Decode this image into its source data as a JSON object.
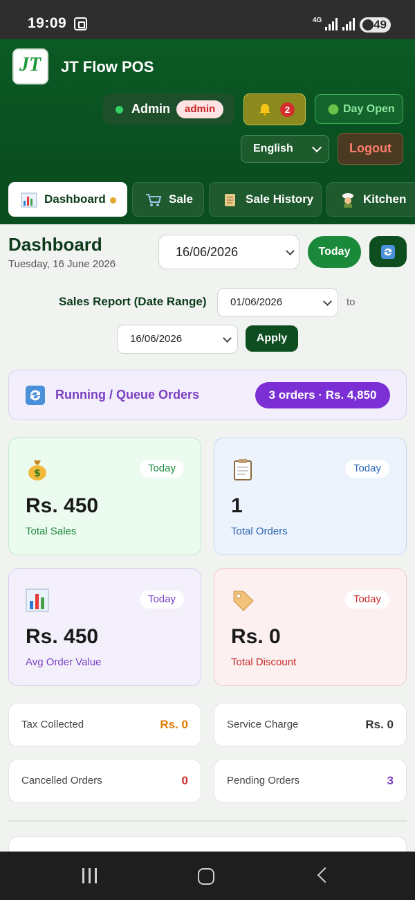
{
  "status_bar": {
    "time": "19:09",
    "network": "4G",
    "battery": "49"
  },
  "header": {
    "app_title": "JT Flow POS",
    "user_name": "Admin",
    "user_role": "admin",
    "notification_count": "2",
    "day_status": "Day Open",
    "language": "English",
    "logout_label": "Logout"
  },
  "tabs": [
    {
      "label": "Dashboard",
      "active": true
    },
    {
      "label": "Sale"
    },
    {
      "label": "Sale History"
    },
    {
      "label": "Kitchen"
    }
  ],
  "dashboard": {
    "title": "Dashboard",
    "date_long": "Tuesday, 16 June 2026",
    "selected_date": "16/06/2026",
    "today_label": "Today",
    "range_label": "Sales Report (Date Range)",
    "range_from": "01/06/2026",
    "range_to_word": "to",
    "range_to": "16/06/2026",
    "apply_label": "Apply"
  },
  "running_orders": {
    "label": "Running / Queue Orders",
    "summary": "3 orders · Rs. 4,850"
  },
  "stats": [
    {
      "value": "Rs. 450",
      "label": "Total Sales",
      "period": "Today",
      "color": "#1e8a3c"
    },
    {
      "value": "1",
      "label": "Total Orders",
      "period": "Today",
      "color": "#2a64b4"
    },
    {
      "value": "Rs. 450",
      "label": "Avg Order Value",
      "period": "Today",
      "color": "#7b3fc4"
    },
    {
      "value": "Rs. 0",
      "label": "Total Discount",
      "period": "Today",
      "color": "#c62828"
    }
  ],
  "mini_stats": [
    {
      "label": "Tax Collected",
      "value": "Rs. 0",
      "color": "#e07b00"
    },
    {
      "label": "Service Charge",
      "value": "Rs. 0",
      "color": "#333333"
    },
    {
      "label": "Cancelled Orders",
      "value": "0",
      "color": "#d32f2f"
    },
    {
      "label": "Pending Orders",
      "value": "3",
      "color": "#7b3fc4"
    }
  ]
}
